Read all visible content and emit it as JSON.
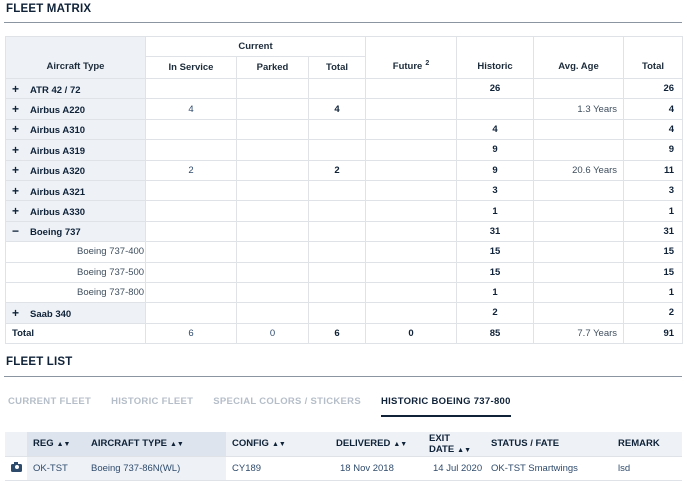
{
  "matrix": {
    "title": "FLEET MATRIX",
    "headers": {
      "aircraft_type": "Aircraft Type",
      "current": "Current",
      "in_service": "In Service",
      "parked": "Parked",
      "total": "Total",
      "future": "Future",
      "future_note": "2",
      "historic": "Historic",
      "avg_age": "Avg. Age",
      "grand_total": "Total"
    },
    "rows": [
      {
        "expander": "+",
        "type": "ATR 42 / 72",
        "in_service": "",
        "parked": "",
        "total": "",
        "future": "",
        "historic": "26",
        "avg_age": "",
        "grand_total": "26"
      },
      {
        "expander": "+",
        "type": "Airbus A220",
        "in_service": "4",
        "parked": "",
        "total": "4",
        "future": "",
        "historic": "",
        "avg_age": "1.3 Years",
        "grand_total": "4"
      },
      {
        "expander": "+",
        "type": "Airbus A310",
        "in_service": "",
        "parked": "",
        "total": "",
        "future": "",
        "historic": "4",
        "avg_age": "",
        "grand_total": "4"
      },
      {
        "expander": "+",
        "type": "Airbus A319",
        "in_service": "",
        "parked": "",
        "total": "",
        "future": "",
        "historic": "9",
        "avg_age": "",
        "grand_total": "9"
      },
      {
        "expander": "+",
        "type": "Airbus A320",
        "in_service": "2",
        "parked": "",
        "total": "2",
        "future": "",
        "historic": "9",
        "avg_age": "20.6 Years",
        "grand_total": "11"
      },
      {
        "expander": "+",
        "type": "Airbus A321",
        "in_service": "",
        "parked": "",
        "total": "",
        "future": "",
        "historic": "3",
        "avg_age": "",
        "grand_total": "3"
      },
      {
        "expander": "+",
        "type": "Airbus A330",
        "in_service": "",
        "parked": "",
        "total": "",
        "future": "",
        "historic": "1",
        "avg_age": "",
        "grand_total": "1"
      },
      {
        "expander": "−",
        "type": "Boeing 737",
        "in_service": "",
        "parked": "",
        "total": "",
        "future": "",
        "historic": "31",
        "avg_age": "",
        "grand_total": "31"
      },
      {
        "sub": true,
        "type": "Boeing 737-400",
        "in_service": "",
        "parked": "",
        "total": "",
        "future": "",
        "historic": "15",
        "avg_age": "",
        "grand_total": "15"
      },
      {
        "sub": true,
        "type": "Boeing 737-500",
        "in_service": "",
        "parked": "",
        "total": "",
        "future": "",
        "historic": "15",
        "avg_age": "",
        "grand_total": "15"
      },
      {
        "sub": true,
        "type": "Boeing 737-800",
        "in_service": "",
        "parked": "",
        "total": "",
        "future": "",
        "historic": "1",
        "avg_age": "",
        "grand_total": "1"
      },
      {
        "expander": "+",
        "type": "Saab 340",
        "in_service": "",
        "parked": "",
        "total": "",
        "future": "",
        "historic": "2",
        "avg_age": "",
        "grand_total": "2"
      }
    ],
    "total_row": {
      "type": "Total",
      "in_service": "6",
      "parked": "0",
      "total": "6",
      "future": "0",
      "historic": "85",
      "avg_age": "7.7 Years",
      "grand_total": "91"
    }
  },
  "fleet_list": {
    "title": "FLEET LIST",
    "tabs": [
      {
        "label": "CURRENT FLEET",
        "active": false
      },
      {
        "label": "HISTORIC FLEET",
        "active": false
      },
      {
        "label": "SPECIAL COLORS / STICKERS",
        "active": false
      },
      {
        "label": "HISTORIC BOEING 737-800",
        "active": true
      }
    ],
    "columns": {
      "reg": "REG",
      "aircraft_type": "AIRCRAFT TYPE",
      "config": "CONFIG",
      "delivered": "DELIVERED",
      "exit_date": "EXIT DATE",
      "status": "STATUS / FATE",
      "remark": "REMARK"
    },
    "sort_icon": "sort-up-down-icon",
    "rows": [
      {
        "icon": "camera-icon",
        "reg": "OK-TST",
        "aircraft_type": "Boeing 737-86N(WL)",
        "config": "CY189",
        "delivered": "18 Nov 2018",
        "exit_date": "14 Jul 2020",
        "status": "OK-TST Smartwings",
        "remark": "lsd"
      }
    ]
  }
}
